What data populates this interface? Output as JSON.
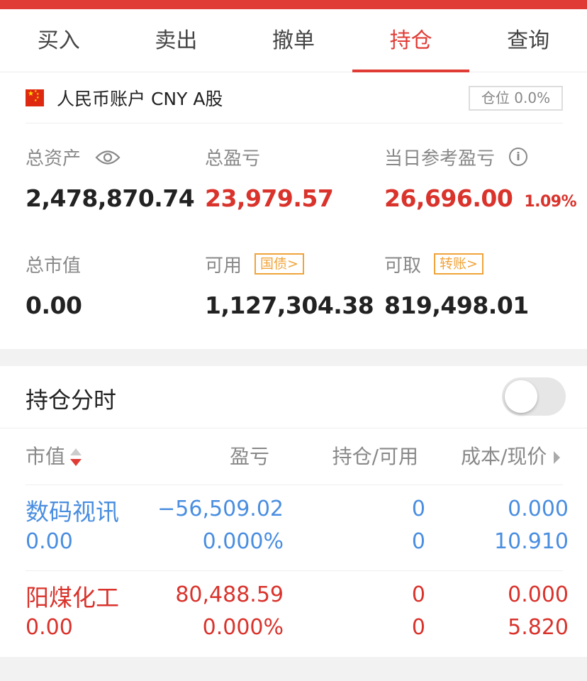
{
  "colors": {
    "accent": "#e03c35",
    "up": "#d9332c",
    "down": "#4a8ee0",
    "tag": "#f0a43a"
  },
  "tabs": [
    {
      "label": "买入",
      "active": false
    },
    {
      "label": "卖出",
      "active": false
    },
    {
      "label": "撤单",
      "active": false
    },
    {
      "label": "持仓",
      "active": true
    },
    {
      "label": "查询",
      "active": false
    }
  ],
  "account": {
    "flag_icon": "china-flag-icon",
    "name": "人民币账户 CNY A股",
    "position_badge": "仓位 0.0%",
    "stats": {
      "total_assets": {
        "label": "总资产",
        "value": "2,478,870.74"
      },
      "total_pnl": {
        "label": "总盈亏",
        "value": "23,979.57"
      },
      "daily_pnl": {
        "label": "当日参考盈亏",
        "value": "26,696.00",
        "percent": "1.09%"
      },
      "market_value": {
        "label": "总市值",
        "value": "0.00"
      },
      "available": {
        "label": "可用",
        "value": "1,127,304.38",
        "tag": "国债>"
      },
      "withdrawable": {
        "label": "可取",
        "value": "819,498.01",
        "tag": "转账>"
      }
    }
  },
  "holdings": {
    "title": "持仓分时",
    "toggle_on": false,
    "columns": {
      "market_value": "市值",
      "pnl": "盈亏",
      "qty": "持仓/可用",
      "cost": "成本/现价"
    },
    "rows": [
      {
        "name": "数码视讯",
        "market_value": "0.00",
        "pnl": "−56,509.02",
        "pnl_pct": "0.000%",
        "position": "0",
        "available": "0",
        "cost": "0.000",
        "price": "10.910",
        "color": "#4a8ee0"
      },
      {
        "name": "阳煤化工",
        "market_value": "0.00",
        "pnl": "80,488.59",
        "pnl_pct": "0.000%",
        "position": "0",
        "available": "0",
        "cost": "0.000",
        "price": "5.820",
        "color": "#d9332c"
      }
    ]
  }
}
